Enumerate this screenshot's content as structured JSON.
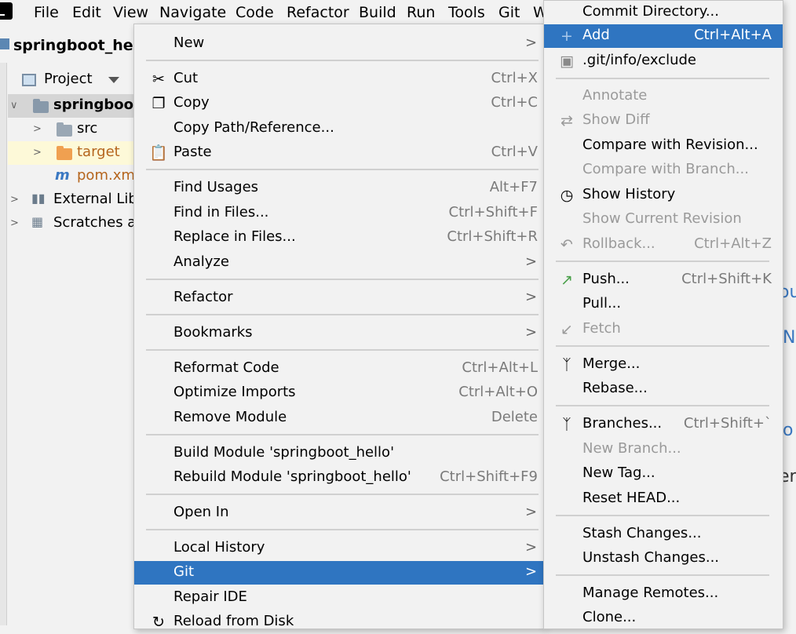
{
  "menubar": {
    "items": [
      "File",
      "Edit",
      "View",
      "Navigate",
      "Code",
      "Refactor",
      "Build",
      "Run",
      "Tools",
      "Git",
      "W"
    ]
  },
  "project": {
    "title": "springboot_hello",
    "panel_label": "Project"
  },
  "tree": [
    {
      "label": "springboot_"
    },
    {
      "label": "src"
    },
    {
      "label": "target"
    },
    {
      "label": "pom.xml"
    },
    {
      "label": "External Libr"
    },
    {
      "label": "Scratches ar"
    }
  ],
  "right_peek": [
    "ou",
    "N",
    "o",
    "en"
  ],
  "context_menu": {
    "items": [
      {
        "label": "New",
        "shortcut": ""
      },
      {
        "label": "Cut",
        "shortcut": "Ctrl+X"
      },
      {
        "label": "Copy",
        "shortcut": "Ctrl+C"
      },
      {
        "label": "Copy Path/Reference...",
        "shortcut": ""
      },
      {
        "label": "Paste",
        "shortcut": "Ctrl+V"
      },
      {
        "label": "Find Usages",
        "shortcut": "Alt+F7"
      },
      {
        "label": "Find in Files...",
        "shortcut": "Ctrl+Shift+F"
      },
      {
        "label": "Replace in Files...",
        "shortcut": "Ctrl+Shift+R"
      },
      {
        "label": "Analyze",
        "shortcut": ""
      },
      {
        "label": "Refactor",
        "shortcut": ""
      },
      {
        "label": "Bookmarks",
        "shortcut": ""
      },
      {
        "label": "Reformat Code",
        "shortcut": "Ctrl+Alt+L"
      },
      {
        "label": "Optimize Imports",
        "shortcut": "Ctrl+Alt+O"
      },
      {
        "label": "Remove Module",
        "shortcut": "Delete"
      },
      {
        "label": "Build Module 'springboot_hello'",
        "shortcut": ""
      },
      {
        "label": "Rebuild Module 'springboot_hello'",
        "shortcut": "Ctrl+Shift+F9"
      },
      {
        "label": "Open In",
        "shortcut": ""
      },
      {
        "label": "Local History",
        "shortcut": ""
      },
      {
        "label": "Git",
        "shortcut": ""
      },
      {
        "label": "Repair IDE",
        "shortcut": ""
      },
      {
        "label": "Reload from Disk",
        "shortcut": ""
      }
    ]
  },
  "git_menu": {
    "items": [
      {
        "label": "Commit Directory...",
        "shortcut": ""
      },
      {
        "label": "Add",
        "shortcut": "Ctrl+Alt+A"
      },
      {
        "label": ".git/info/exclude",
        "shortcut": ""
      },
      {
        "label": "Annotate",
        "shortcut": ""
      },
      {
        "label": "Show Diff",
        "shortcut": ""
      },
      {
        "label": "Compare with Revision...",
        "shortcut": ""
      },
      {
        "label": "Compare with Branch...",
        "shortcut": ""
      },
      {
        "label": "Show History",
        "shortcut": ""
      },
      {
        "label": "Show Current Revision",
        "shortcut": ""
      },
      {
        "label": "Rollback...",
        "shortcut": "Ctrl+Alt+Z"
      },
      {
        "label": "Push...",
        "shortcut": "Ctrl+Shift+K"
      },
      {
        "label": "Pull...",
        "shortcut": ""
      },
      {
        "label": "Fetch",
        "shortcut": ""
      },
      {
        "label": "Merge...",
        "shortcut": ""
      },
      {
        "label": "Rebase...",
        "shortcut": ""
      },
      {
        "label": "Branches...",
        "shortcut": "Ctrl+Shift+`"
      },
      {
        "label": "New Branch...",
        "shortcut": ""
      },
      {
        "label": "New Tag...",
        "shortcut": ""
      },
      {
        "label": "Reset HEAD...",
        "shortcut": ""
      },
      {
        "label": "Stash Changes...",
        "shortcut": ""
      },
      {
        "label": "Unstash Changes...",
        "shortcut": ""
      },
      {
        "label": "Manage Remotes...",
        "shortcut": ""
      },
      {
        "label": "Clone...",
        "shortcut": ""
      }
    ]
  },
  "colors": {
    "highlight": "#2f75c1",
    "menu_bg": "#f2f2f2",
    "disabled_text": "#9a9a9a",
    "shortcut_text": "#7a7a7a"
  }
}
